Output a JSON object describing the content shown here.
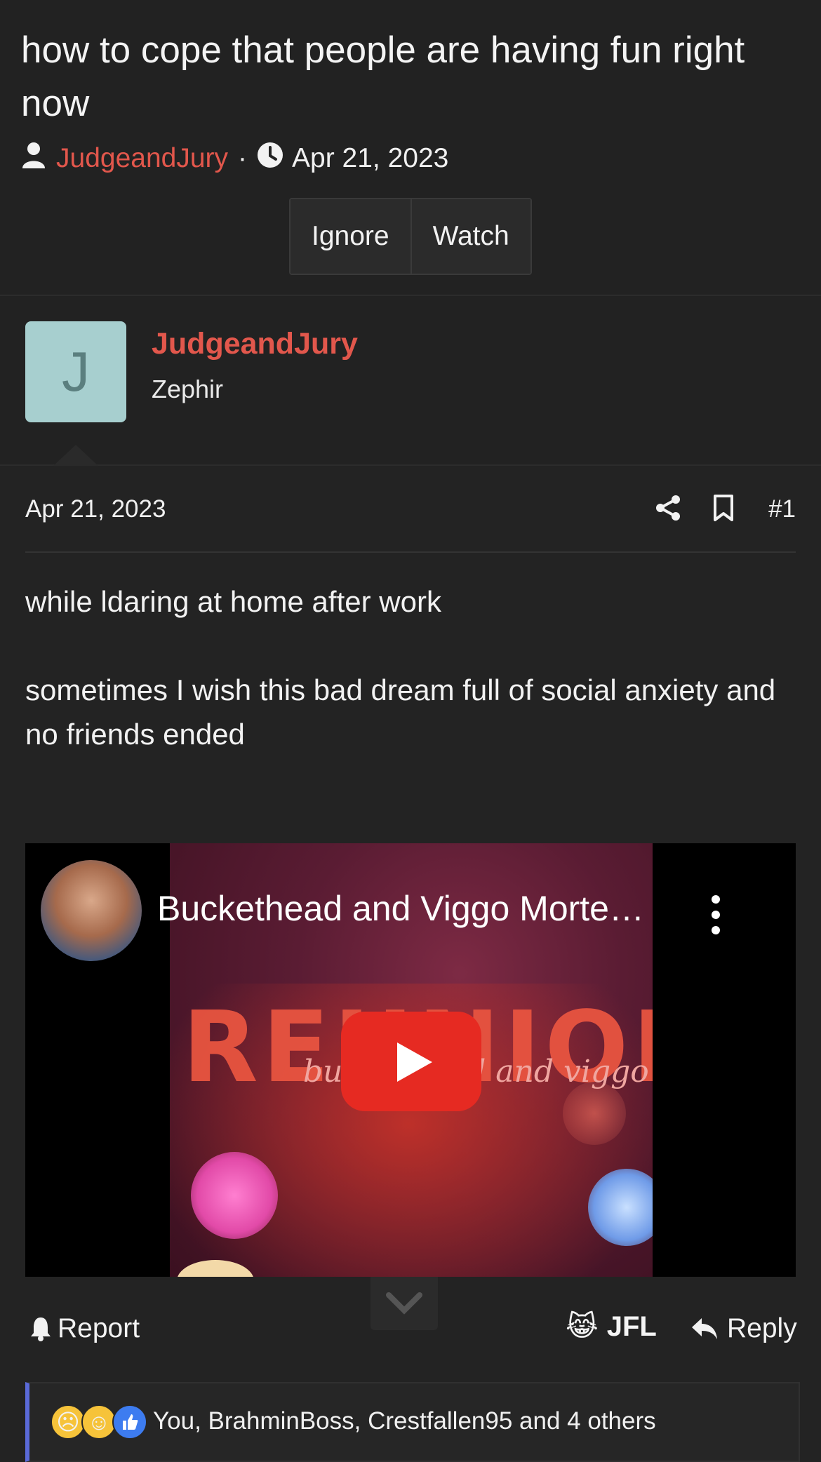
{
  "thread": {
    "title": "how to cope that people are having fun right now",
    "author": "JudgeandJury",
    "separator": "·",
    "date": "Apr 21, 2023",
    "buttons": {
      "ignore": "Ignore",
      "watch": "Watch"
    }
  },
  "post": {
    "user": {
      "avatar_letter": "J",
      "name": "JudgeandJury",
      "title": "Zephir"
    },
    "date": "Apr 21, 2023",
    "number": "#1",
    "paragraphs": [
      "while ldaring at home after work",
      "sometimes I wish this bad dream full of social anxiety and no friends ended"
    ],
    "video": {
      "title": "Buckethead and Viggo Morte…",
      "thumb_word": "REUNION",
      "thumb_sub": "buckethead and viggo"
    }
  },
  "actions": {
    "report": "Report",
    "jfl": "JFL",
    "reply": "Reply"
  },
  "reactions": {
    "text": "You, BrahminBoss, Crestfallen95 and 4 others"
  },
  "colors": {
    "accent": "#e2574c",
    "background": "#232323",
    "reaction_bar": "#5a6ad8",
    "play": "#e62a22"
  }
}
